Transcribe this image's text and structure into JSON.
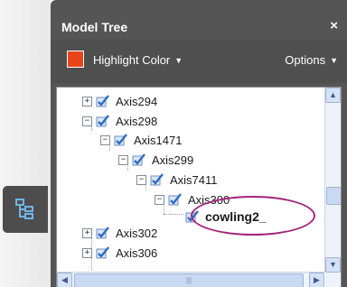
{
  "panel": {
    "title": "Model Tree",
    "close_label": "×"
  },
  "toolbar": {
    "highlight_color_label": "Highlight Color",
    "highlight_color": "#e8451b",
    "options_label": "Options",
    "caret": "▼"
  },
  "tree": {
    "nodes": [
      {
        "label": "Axis294",
        "expander": "+",
        "checked": true
      },
      {
        "label": "Axis298",
        "expander": "−",
        "checked": true
      },
      {
        "label": "Axis1471",
        "expander": "−",
        "checked": true
      },
      {
        "label": "Axis299",
        "expander": "−",
        "checked": true
      },
      {
        "label": "Axis7411",
        "expander": "−",
        "checked": true
      },
      {
        "label": "Axis300",
        "expander": "−",
        "checked": true
      },
      {
        "label": "cowling2_",
        "expander": "",
        "checked": true
      },
      {
        "label": "Axis302",
        "expander": "+",
        "checked": true
      },
      {
        "label": "Axis306",
        "expander": "+",
        "checked": true
      }
    ]
  },
  "scroll": {
    "up": "▲",
    "down": "▼",
    "left": "◀",
    "right": "▶",
    "grip": "|||"
  },
  "side_tab": {
    "icon": "model-tree-icon"
  }
}
